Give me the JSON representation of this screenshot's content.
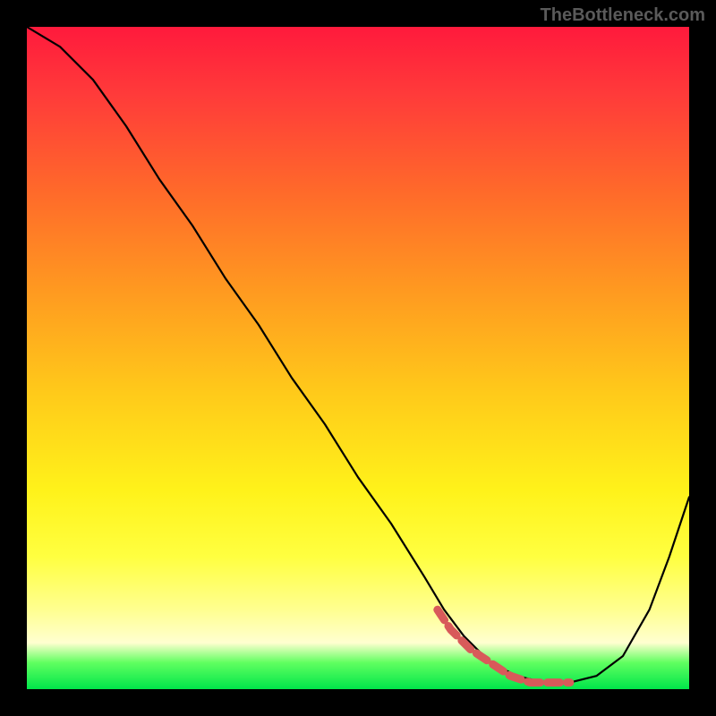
{
  "watermark": "TheBottleneck.com",
  "chart_data": {
    "type": "line",
    "title": "",
    "xlabel": "",
    "ylabel": "",
    "xlim": [
      0,
      100
    ],
    "ylim": [
      0,
      100
    ],
    "grid": false,
    "legend": null,
    "series": [
      {
        "name": "bottleneck-curve",
        "x": [
          0,
          5,
          10,
          15,
          20,
          25,
          30,
          35,
          40,
          45,
          50,
          55,
          60,
          63,
          66,
          70,
          74,
          78,
          82,
          86,
          90,
          94,
          97,
          100
        ],
        "values": [
          100,
          97,
          92,
          85,
          77,
          70,
          62,
          55,
          47,
          40,
          32,
          25,
          17,
          12,
          8,
          4,
          2,
          1,
          1,
          2,
          5,
          12,
          20,
          29
        ]
      }
    ],
    "highlight_segment": {
      "name": "optimal-zone",
      "x": [
        62,
        64,
        67,
        70,
        73,
        76,
        79,
        82
      ],
      "values": [
        12,
        9,
        6,
        4,
        2,
        1,
        1,
        1
      ]
    },
    "background_gradient": {
      "top": "#ff1a3c",
      "mid": "#fff21a",
      "bottom": "#00e54a"
    }
  }
}
